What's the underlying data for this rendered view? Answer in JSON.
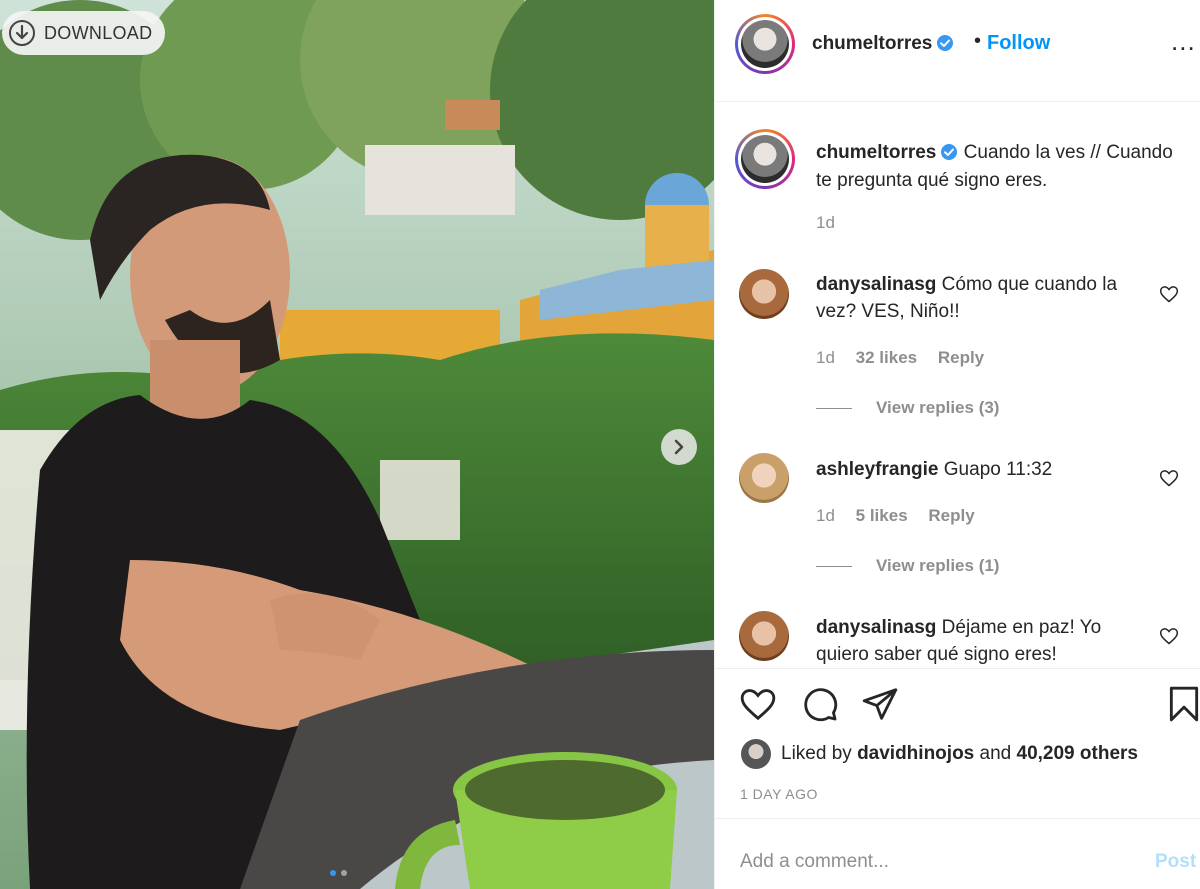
{
  "photo": {
    "download_label": "DOWNLOAD",
    "icons": {
      "download": "download-circle-icon",
      "next": "chevron-right-icon"
    },
    "carousel": {
      "slide_count": 2,
      "current_slide": 1
    }
  },
  "header": {
    "username": "chumeltorres",
    "separator": "•",
    "follow_label": "Follow",
    "more_label": "..."
  },
  "caption": {
    "username": "chumeltorres",
    "text": "Cuando la ves // Cuando te pregunta qué signo eres.",
    "time": "1d"
  },
  "comments": [
    {
      "username": "danysalinasg",
      "text": "Cómo que cuando la vez? VES, Niño!!",
      "time": "1d",
      "likes": "32 likes",
      "reply_label": "Reply",
      "view_replies": "View replies (3)"
    },
    {
      "username": "ashleyfrangie",
      "text": "Guapo 11:32",
      "time": "1d",
      "likes": "5 likes",
      "reply_label": "Reply",
      "view_replies": "View replies (1)"
    },
    {
      "username": "danysalinasg",
      "text": "Déjame en paz! Yo quiero saber qué signo eres!"
    }
  ],
  "actions": {
    "liked_prefix": "Liked by",
    "liked_user": "davidhinojos",
    "liked_and": "and",
    "liked_others": "40,209 others",
    "date": "1 DAY AGO"
  },
  "add_comment": {
    "placeholder": "Add a comment...",
    "post_label": "Post"
  },
  "colors": {
    "link_blue": "#0095f6",
    "post_disabled": "#b2dffc",
    "muted": "#8e8e8e",
    "text": "#262626",
    "verified": "#3897f0"
  }
}
